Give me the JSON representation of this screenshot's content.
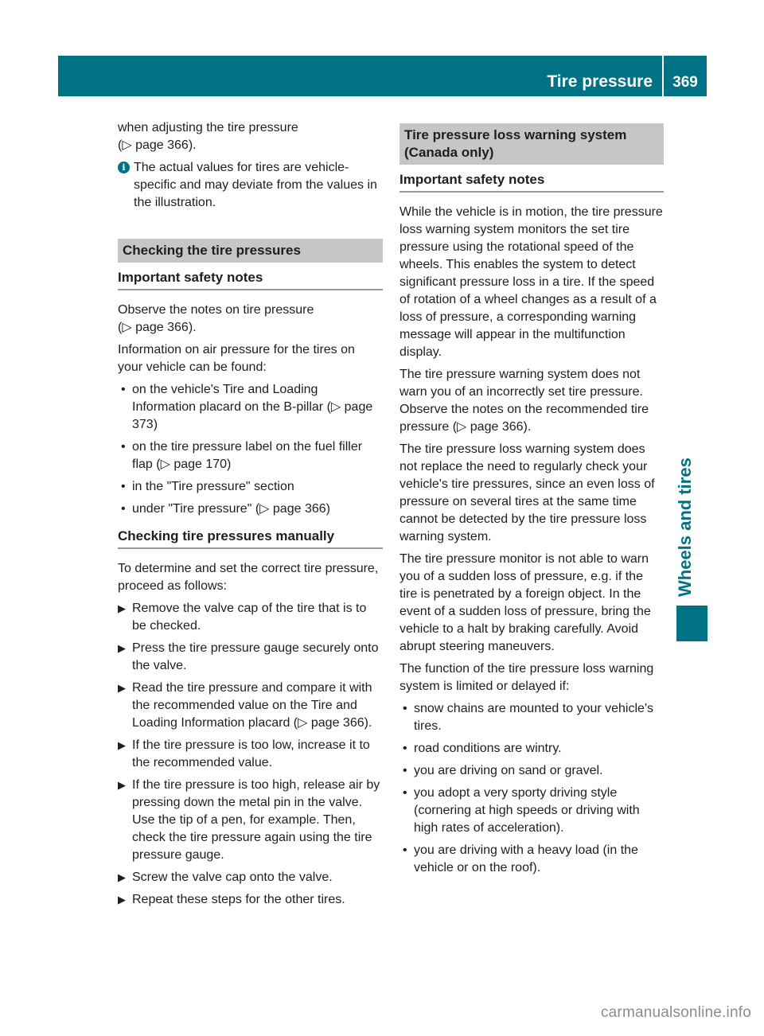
{
  "header": {
    "section_title": "Tire pressure",
    "page_number": "369",
    "accent_color": "#007285"
  },
  "side_tab": {
    "label": "Wheels and tires"
  },
  "left_column": {
    "intro_line1": "when adjusting the tire pressure",
    "intro_ref": "(▷ page 366).",
    "info_icon": "info-icon",
    "info_text": "The actual values for tires are vehicle-specific and may deviate from the values in the illustration.",
    "section_heading": "Checking the tire pressures",
    "subheading1": "Important safety notes",
    "para1_line1": "Observe the notes on tire pressure",
    "para1_ref": "(▷ page 366).",
    "para2": "Information on air pressure for the tires on your vehicle can be found:",
    "bullets": [
      "on the vehicle's Tire and Loading Information placard on the B-pillar (▷ page 373)",
      "on the tire pressure label on the fuel filler flap (▷ page 170)",
      "in the \"Tire pressure\" section",
      "under \"Tire pressure\" (▷ page 366)"
    ],
    "subheading2": "Checking tire pressures manually",
    "para3": "To determine and set the correct tire pressure, proceed as follows:",
    "steps": [
      "Remove the valve cap of the tire that is to be checked.",
      "Press the tire pressure gauge securely onto the valve.",
      "Read the tire pressure and compare it with the recommended value on the Tire and Loading Information placard (▷ page 366).",
      "If the tire pressure is too low, increase it to the recommended value.",
      "If the tire pressure is too high, release air by pressing down the metal pin in the valve. Use the tip of a pen, for example. Then, check the tire pressure again using the tire pressure gauge.",
      "Screw the valve cap onto the valve.",
      "Repeat these steps for the other tires."
    ]
  },
  "right_column": {
    "section_heading": "Tire pressure loss warning system (Canada only)",
    "subheading": "Important safety notes",
    "paragraphs": [
      "While the vehicle is in motion, the tire pressure loss warning system monitors the set tire pressure using the rotational speed of the wheels. This enables the system to detect significant pressure loss in a tire. If the speed of rotation of a wheel changes as a result of a loss of pressure, a corresponding warning message will appear in the multifunction display.",
      "The tire pressure warning system does not warn you of an incorrectly set tire pressure. Observe the notes on the recommended tire pressure (▷ page 366).",
      "The tire pressure loss warning system does not replace the need to regularly check your vehicle's tire pressures, since an even loss of pressure on several tires at the same time cannot be detected by the tire pressure loss warning system.",
      "The tire pressure monitor is not able to warn you of a sudden loss of pressure, e.g. if the tire is penetrated by a foreign object. In the event of a sudden loss of pressure, bring the vehicle to a halt by braking carefully. Avoid abrupt steering maneuvers.",
      "The function of the tire pressure loss warning system is limited or delayed if:"
    ],
    "bullets": [
      "snow chains are mounted to your vehicle's tires.",
      "road conditions are wintry.",
      "you are driving on sand or gravel.",
      "you adopt a very sporty driving style (cornering at high speeds or driving with high rates of acceleration).",
      "you are driving with a heavy load (in the vehicle or on the roof)."
    ]
  },
  "watermark": "carmanualsonline.info"
}
